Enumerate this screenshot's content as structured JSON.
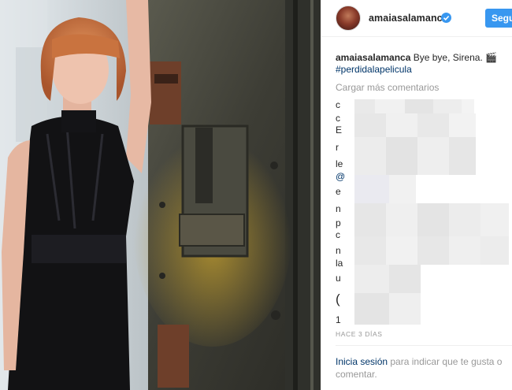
{
  "post": {
    "username": "amaiasalamanca",
    "follow_label": "Seguir",
    "caption_text": " Bye bye, Sirena. 🎬",
    "hashtag": "#perdidalapelicula",
    "load_more": "Cargar más comentarios",
    "timestamp": "HACE 3 DÍAS"
  },
  "comments": [
    {
      "initial": "c"
    },
    {
      "initial": "c"
    },
    {
      "initial": "E"
    },
    {
      "initial": "r"
    },
    {
      "initial": "le"
    },
    {
      "initial": "@"
    },
    {
      "initial": "e"
    },
    {
      "initial": "n"
    },
    {
      "initial": "p"
    },
    {
      "initial": "c"
    },
    {
      "initial": "n"
    },
    {
      "initial": "la"
    },
    {
      "initial": "u"
    },
    {
      "initial": "("
    },
    {
      "initial": "1"
    }
  ],
  "footer": {
    "login_link": "Inicia sesión",
    "login_rest": " para indicar que te gusta o comentar."
  },
  "colors": {
    "accent": "#3897f0",
    "link": "#003569",
    "muted": "#999999"
  }
}
